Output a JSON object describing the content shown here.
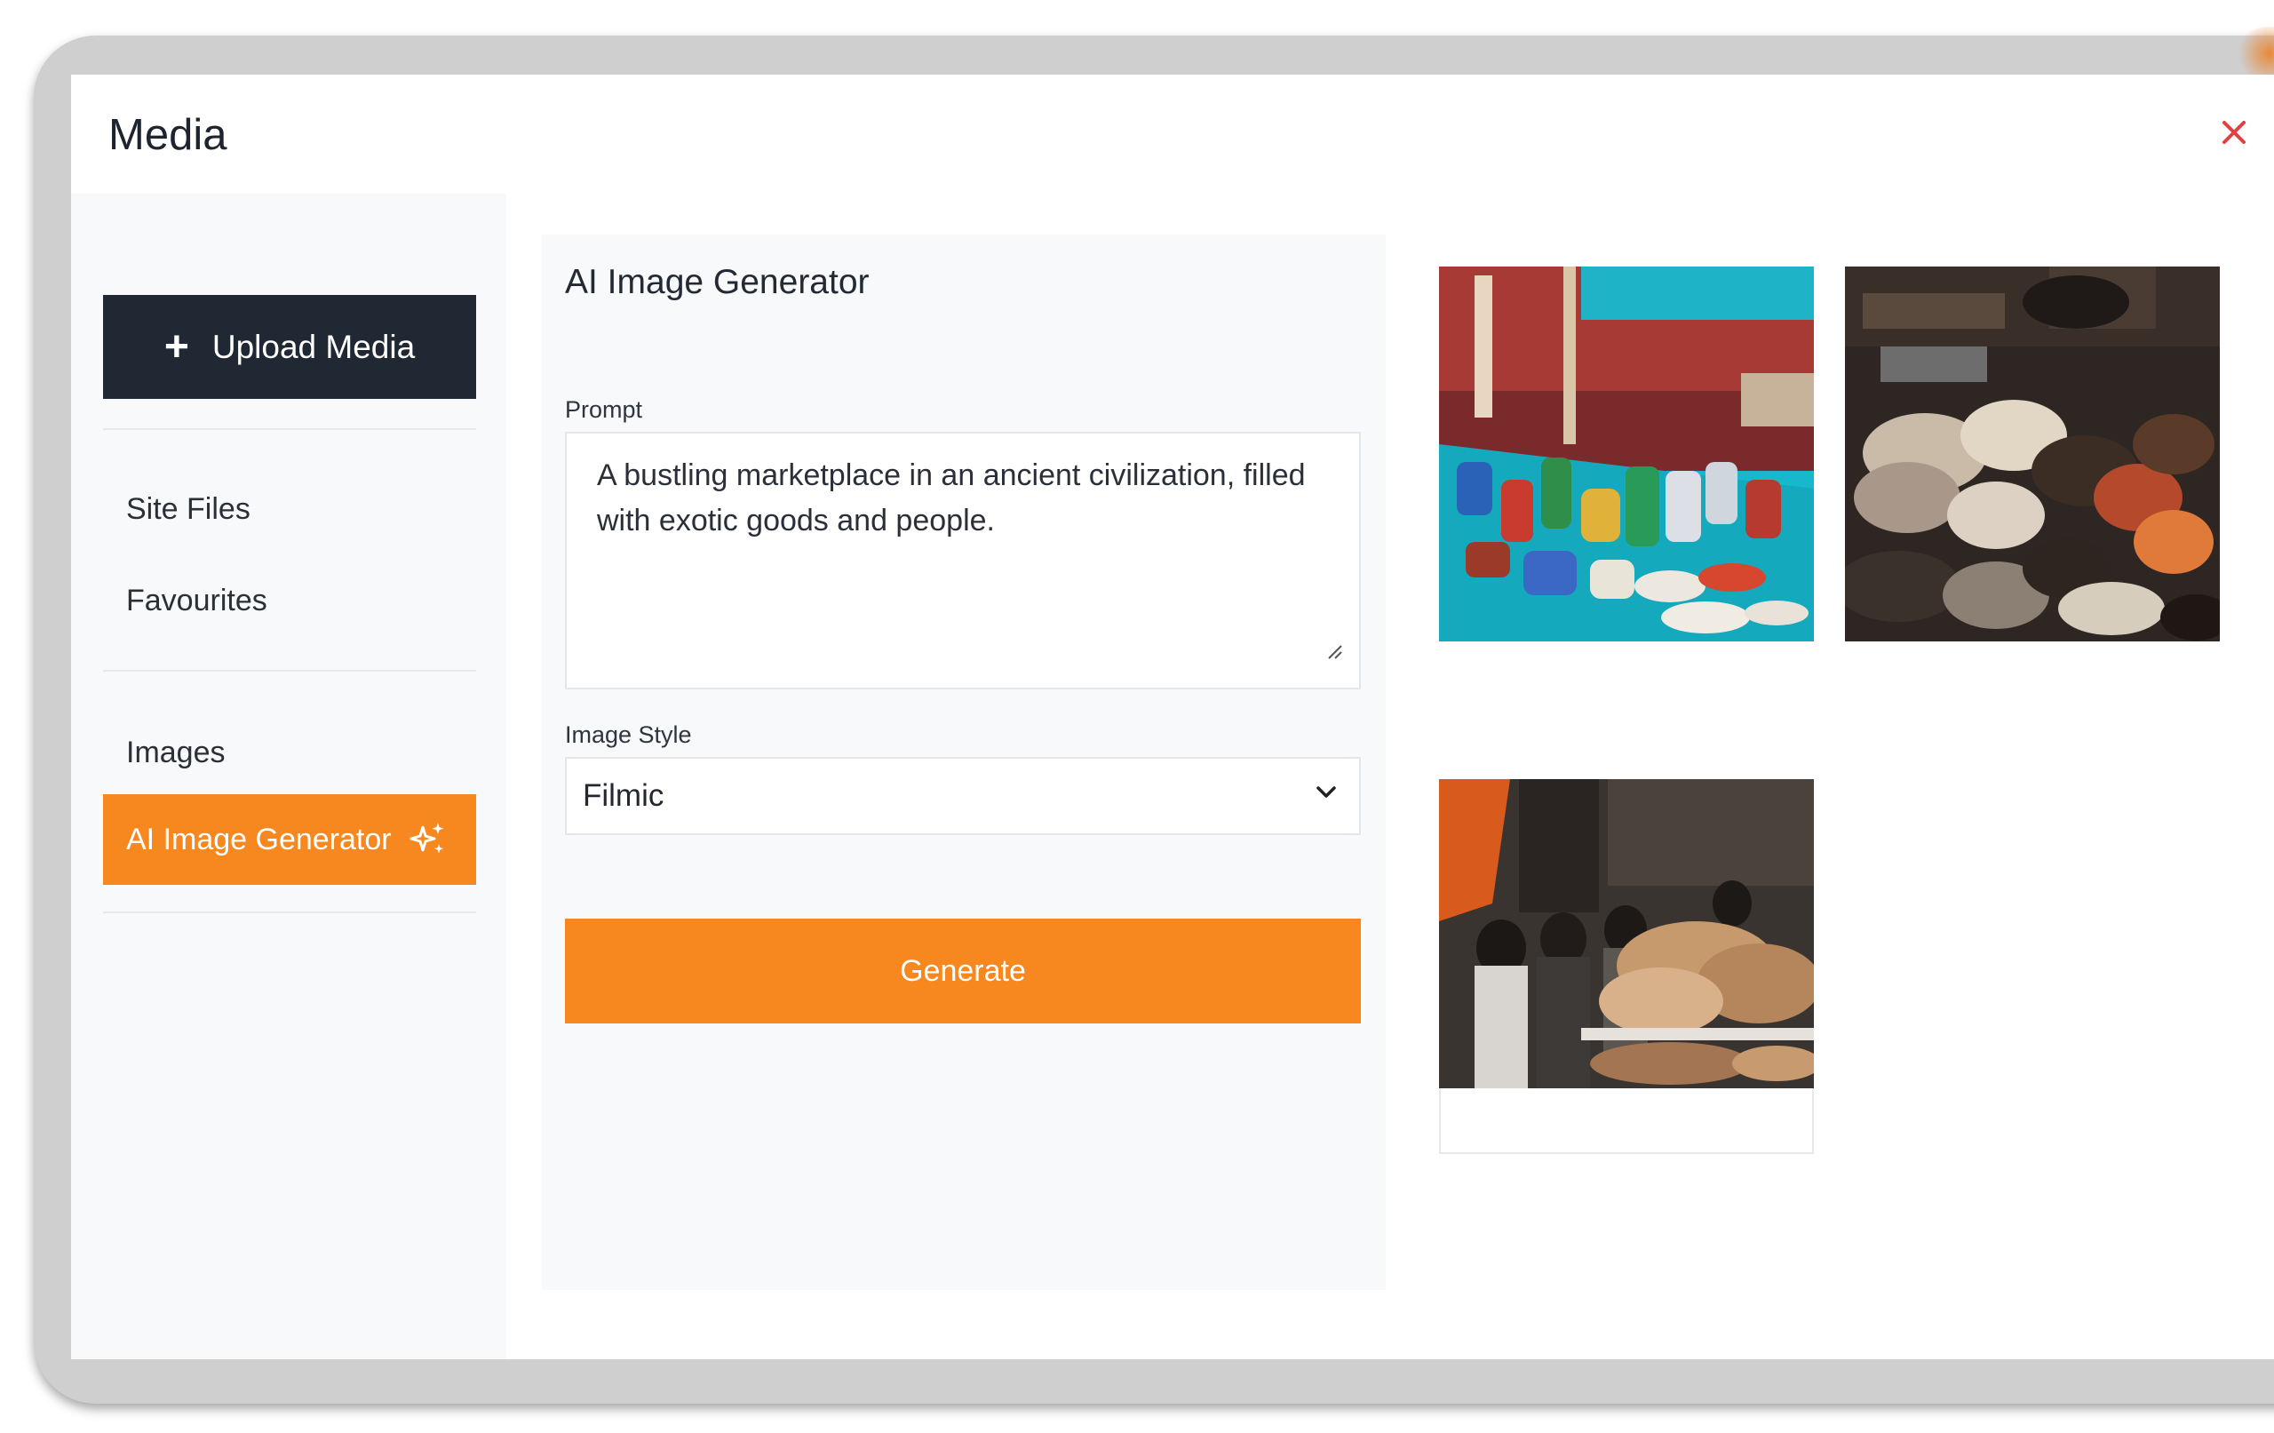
{
  "modal": {
    "title": "Media",
    "close_icon": "close-icon",
    "close_color": "#e04040"
  },
  "sidebar": {
    "upload_label": "Upload Media",
    "upload_icon": "plus-icon",
    "items": [
      {
        "label": "Site Files"
      },
      {
        "label": "Favourites"
      },
      {
        "label": "Images"
      },
      {
        "label": "AI Image Generator",
        "icon": "sparkle-icon",
        "active": true
      }
    ]
  },
  "generator": {
    "title": "AI Image Generator",
    "prompt_label": "Prompt",
    "prompt_value": "A bustling marketplace in an ancient civilization, filled with exotic goods and people.",
    "style_label": "Image Style",
    "style_value": "Filmic",
    "generate_label": "Generate"
  },
  "results": [
    {
      "name": "marketplace-image-1",
      "depicts": "colorful glass jars on a turquoise market table"
    },
    {
      "name": "marketplace-image-2",
      "depicts": "heaps of dried mushrooms and goods at a stall"
    },
    {
      "name": "marketplace-image-3",
      "depicts": "crowd of people browsing a busy market stall"
    }
  ],
  "colors": {
    "accent": "#f7871f",
    "dark_button": "#1f2833",
    "panel_bg": "#f8f9fa"
  }
}
